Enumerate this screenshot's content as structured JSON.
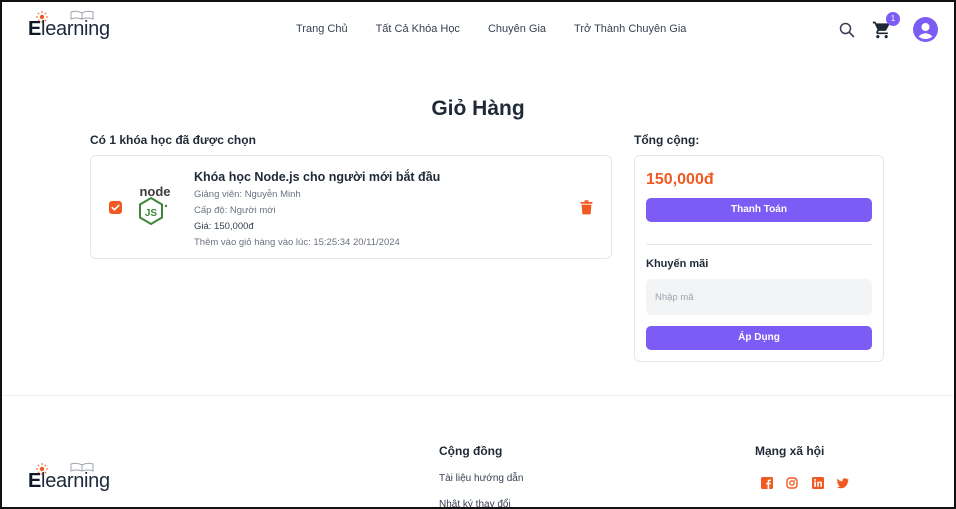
{
  "brand": {
    "logo_text_initial": "E",
    "logo_text_rest": "learning"
  },
  "header": {
    "nav": [
      "Trang Chủ",
      "Tất Cả Khóa Học",
      "Chuyên Gia",
      "Trở Thành Chuyên Gia"
    ],
    "cart_count": "1"
  },
  "cart": {
    "title": "Giỏ Hàng",
    "selected_label": "Có 1 khóa học đã được chọn",
    "item": {
      "name": "Khóa học Node.js cho người mới bắt đầu",
      "instructor": "Giảng viên: Nguyễn Minh",
      "level": "Cấp độ: Người mới",
      "price": "Giá: 150,000đ",
      "added_at": "Thêm vào giỏ hàng vào lúc: 15:25:34 20/11/2024",
      "logo_node": "node",
      "logo_js": "JS"
    }
  },
  "summary": {
    "label": "Tổng cộng:",
    "total": "150,000đ",
    "checkout_label": "Thanh Toán",
    "promo_title": "Khuyến mãi",
    "promo_placeholder": "Nhập mã",
    "apply_label": "Áp Dụng"
  },
  "footer": {
    "community_title": "Cộng đồng",
    "links": [
      "Tài liệu hướng dẫn",
      "Nhật ký thay đổi"
    ],
    "social_title": "Mạng xã hội",
    "social_icons": [
      "facebook-icon",
      "instagram-icon",
      "linkedin-icon",
      "twitter-icon"
    ]
  },
  "colors": {
    "accent": "#7c5cf5",
    "brand_orange": "#f05a22",
    "node_green": "#3c873a"
  }
}
